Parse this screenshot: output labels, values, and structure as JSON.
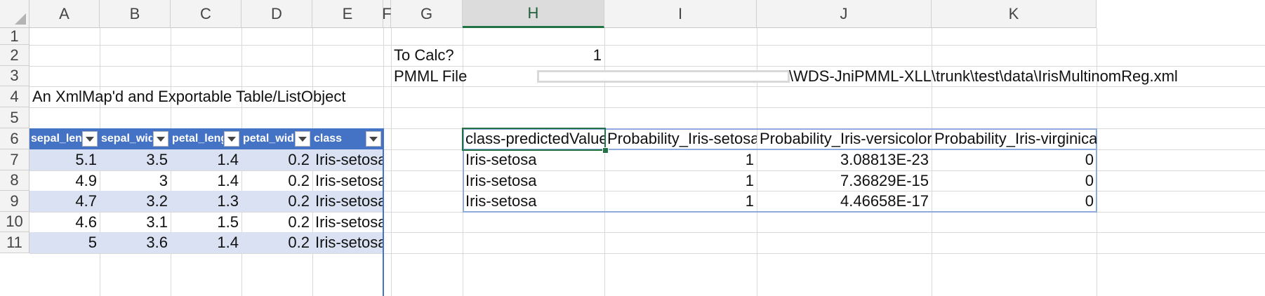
{
  "columns": [
    "A",
    "B",
    "C",
    "D",
    "E",
    "F",
    "G",
    "H",
    "I",
    "J",
    "K"
  ],
  "rows": [
    "1",
    "2",
    "3",
    "4",
    "5",
    "6",
    "7",
    "8",
    "9",
    "10",
    "11"
  ],
  "selected_column": "H",
  "params": {
    "to_calc_label": "To Calc?",
    "to_calc_value": "1",
    "pmml_label": "PMML File",
    "pmml_path": "\\WDS-JniPMML-XLL\\trunk\\test\\data\\IrisMultinomReg.xml"
  },
  "caption": "An XmlMap'd and Exportable Table/ListObject",
  "iris_table": {
    "headers": [
      "sepal_leng",
      "sepal_widt",
      "petal_leng",
      "petal_widt",
      "class"
    ],
    "rows": [
      [
        "5.1",
        "3.5",
        "1.4",
        "0.2",
        "Iris-setosa"
      ],
      [
        "4.9",
        "3",
        "1.4",
        "0.2",
        "Iris-setosa"
      ],
      [
        "4.7",
        "3.2",
        "1.3",
        "0.2",
        "Iris-setosa"
      ],
      [
        "4.6",
        "3.1",
        "1.5",
        "0.2",
        "Iris-setosa"
      ],
      [
        "5",
        "3.6",
        "1.4",
        "0.2",
        "Iris-setosa"
      ]
    ]
  },
  "prediction_table": {
    "headers": [
      "class-predictedValue",
      "Probability_Iris-setosa",
      "Probability_Iris-versicolor",
      "Probability_Iris-virginica"
    ],
    "rows": [
      [
        "Iris-setosa",
        "1",
        "3.08813E-23",
        "0"
      ],
      [
        "Iris-setosa",
        "1",
        "7.36829E-15",
        "0"
      ],
      [
        "Iris-setosa",
        "1",
        "4.46658E-17",
        "0"
      ]
    ]
  },
  "colors": {
    "table_header": "#4472c4",
    "table_band": "#d9e1f2",
    "selection": "#217346"
  }
}
